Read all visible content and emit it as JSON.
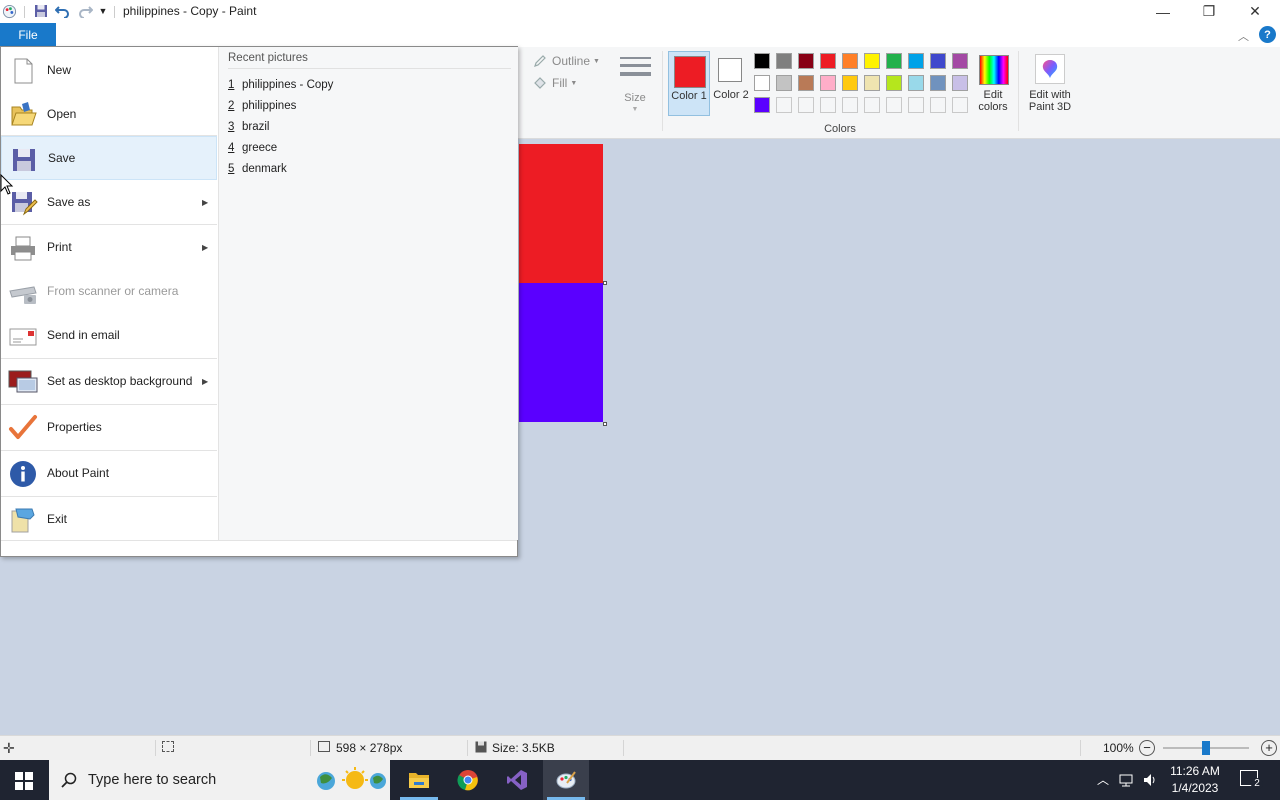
{
  "window": {
    "title": "philippines - Copy - Paint",
    "minimize": "—",
    "restore": "❐",
    "close": "✕"
  },
  "file_tab": "File",
  "ribbon": {
    "outline_label": "Outline",
    "fill_label": "Fill",
    "size_label": "Size",
    "color1_label": "Color 1",
    "color2_label": "Color 2",
    "edit_colors_label": "Edit colors",
    "edit_paint3d_label": "Edit with Paint 3D",
    "colors_group_label": "Colors",
    "color1_value": "#ed1c24",
    "color2_value": "#ffffff",
    "palette_row1": [
      "#000000",
      "#7f7f7f",
      "#880015",
      "#ed1c24",
      "#ff7f27",
      "#fff200",
      "#22b14c",
      "#00a2e8",
      "#3f48cc",
      "#a349a4"
    ],
    "palette_row2": [
      "#ffffff",
      "#c3c3c3",
      "#b97a57",
      "#ffaec9",
      "#ffc90e",
      "#efe4b0",
      "#b5e61d",
      "#99d9ea",
      "#7092be",
      "#c8bfe7"
    ],
    "palette_row3": [
      "#5a00ff",
      "",
      "",
      "",
      "",
      "",
      "",
      "",
      "",
      ""
    ]
  },
  "menu": {
    "items": [
      {
        "label": "New",
        "icon": "new-file-icon"
      },
      {
        "label": "Open",
        "icon": "open-folder-icon"
      },
      {
        "label": "Save",
        "icon": "save-icon"
      },
      {
        "label": "Save as",
        "icon": "save-as-icon"
      },
      {
        "label": "Print",
        "icon": "print-icon"
      },
      {
        "label": "From scanner or camera",
        "icon": "scanner-icon"
      },
      {
        "label": "Send in email",
        "icon": "email-icon"
      },
      {
        "label": "Set as desktop background",
        "icon": "desktop-background-icon"
      },
      {
        "label": "Properties",
        "icon": "properties-check-icon"
      },
      {
        "label": "About Paint",
        "icon": "info-icon"
      },
      {
        "label": "Exit",
        "icon": "exit-icon"
      }
    ],
    "recent_title": "Recent pictures",
    "recent": [
      {
        "num": "1",
        "name": "philippines - Copy"
      },
      {
        "num": "2",
        "name": "philippines"
      },
      {
        "num": "3",
        "name": "brazil"
      },
      {
        "num": "4",
        "name": "greece"
      },
      {
        "num": "5",
        "name": "denmark"
      }
    ]
  },
  "canvas": {
    "top_color": "#ed1c24",
    "bottom_color": "#5a00ff"
  },
  "status": {
    "dimensions": "598 × 278px",
    "size": "Size: 3.5KB",
    "zoom": "100%",
    "zoom_out": "−",
    "zoom_in": "+"
  },
  "taskbar": {
    "search_placeholder": "Type here to search",
    "time": "11:26 AM",
    "date": "1/4/2023",
    "notifications": "2"
  }
}
